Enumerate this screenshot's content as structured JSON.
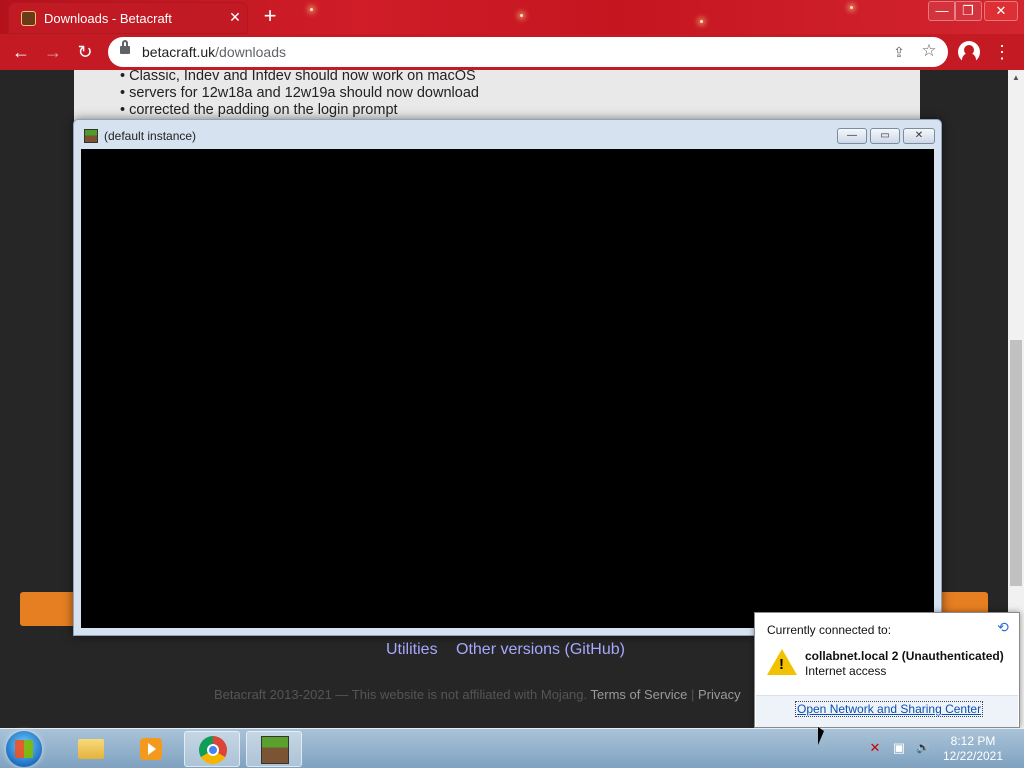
{
  "browser": {
    "tab_title": "Downloads - Betacraft",
    "tab_close": "✕",
    "new_tab": "+",
    "url_domain": "betacraft.uk",
    "url_path": "/downloads",
    "window_controls": {
      "minimize": "—",
      "restore": "❐",
      "close": "✕"
    },
    "nav": {
      "back": "←",
      "forward": "→",
      "reload": "↻"
    },
    "menu": "⋮",
    "share_icon": "⇪",
    "star_icon": "☆"
  },
  "page": {
    "changelog": [
      "Classic, Indev and Infdev should now work on macOS",
      "servers for 12w18a and 12w19a should now download",
      "corrected the padding on the login prompt"
    ],
    "links": {
      "utilities": "Utilities",
      "other_versions": "Other versions (GitHub)"
    },
    "footer": {
      "copyright": "Betacraft 2013-2021 — This website is not affiliated with Mojang.",
      "terms": "Terms of Service",
      "separator": "|",
      "privacy": "Privacy"
    }
  },
  "java_window": {
    "title": "(default instance)",
    "minimize": "—",
    "restore": "▭",
    "close": "✕"
  },
  "network_popup": {
    "header": "Currently connected to:",
    "refresh_icon": "⟲",
    "warning_glyph": "!",
    "network_name": "collabnet.local  2 (Unauthenticated)",
    "network_status": "Internet access",
    "open_center": "Open Network and Sharing Center"
  },
  "taskbar": {
    "time": "8:12 PM",
    "date": "12/22/2021",
    "tray": {
      "network_warning": "✕",
      "network": "▣",
      "volume": "🔊"
    }
  },
  "colors": {
    "browser_red": "#c41a24",
    "orange_button": "#e67e22",
    "link": "#a7a7ff"
  }
}
